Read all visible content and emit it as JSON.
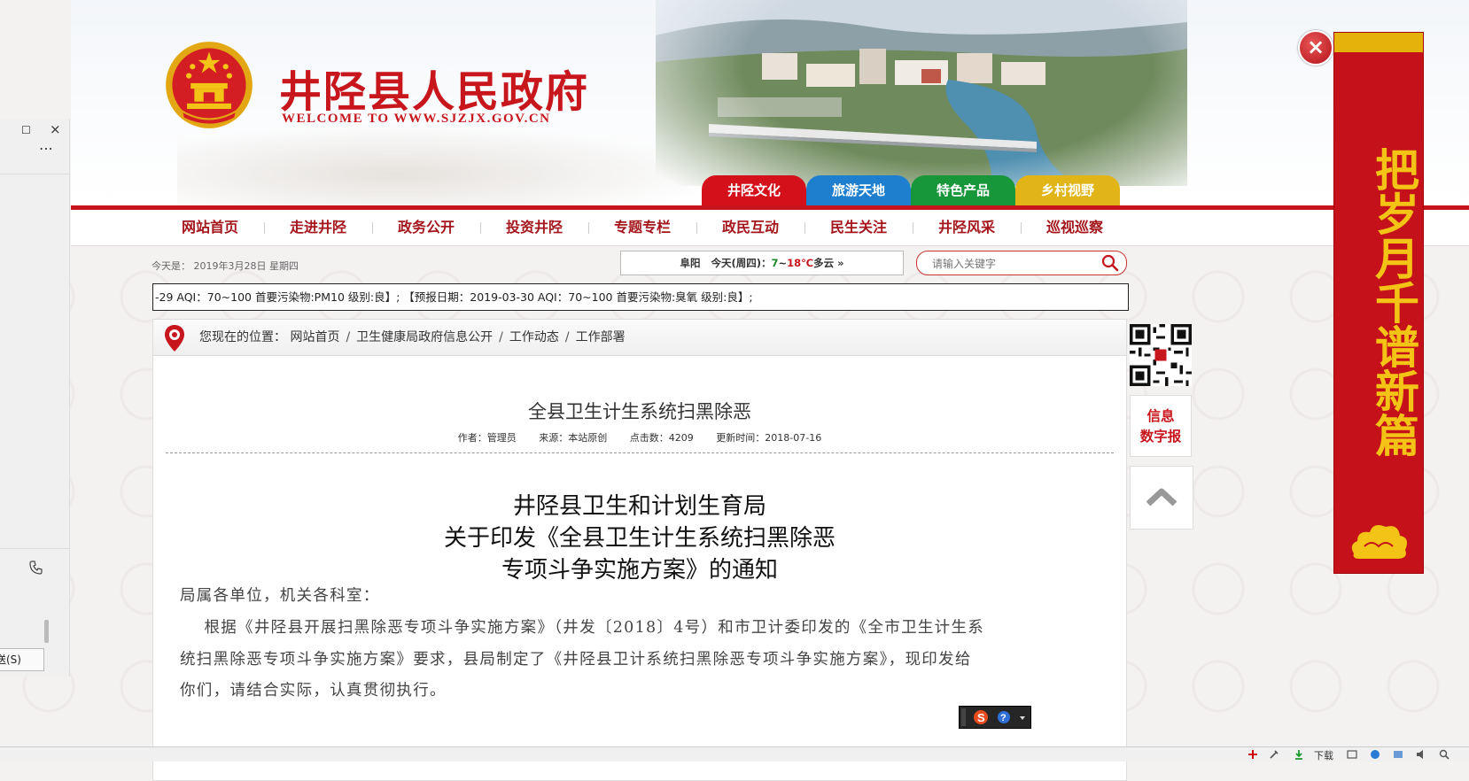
{
  "header": {
    "site_title": "井陉县人民政府",
    "site_subtitle": "WELCOME TO WWW.SJZJX.GOV.CN",
    "category_tabs": [
      {
        "label": "井陉文化",
        "color": "#d4101b"
      },
      {
        "label": "旅游天地",
        "color": "#1e7fcf"
      },
      {
        "label": "特色产品",
        "color": "#18963a"
      },
      {
        "label": "乡村视野",
        "color": "#e1b417"
      }
    ]
  },
  "nav": {
    "items": [
      "网站首页",
      "走进井陉",
      "政务公开",
      "投资井陉",
      "专题专栏",
      "政民互动",
      "民生关注",
      "井陉风采",
      "巡视巡察"
    ]
  },
  "info": {
    "date_label": "今天是：",
    "date_value": "2019年3月28日  星期四",
    "weather_city": "阜阳",
    "weather_day": "今天(周四)：",
    "weather_low": "7",
    "weather_sep": "~",
    "weather_high": "18℃",
    "weather_cond": "多云",
    "weather_more": "»",
    "search_placeholder": "请输入关键字",
    "ticker": "-29 AQI：70~100 首要污染物:PM10 级别:良】; 【预报日期：2019-03-30 AQI：70~100 首要污染物:臭氧 级别:良】;"
  },
  "breadcrumb": {
    "prefix": "您现在的位置：",
    "items": [
      "网站首页",
      "卫生健康局政府信息公开",
      "工作动态",
      "工作部署"
    ],
    "separator": "/"
  },
  "article": {
    "title": "全县卫生计生系统扫黑除恶",
    "author": "作者：管理员",
    "source": "来源：本站原创",
    "hits": "点击数：4209",
    "updated": "更新时间：2018-07-16",
    "doc_heading": [
      "井陉县卫生和计划生育局",
      "关于印发《全县卫生计生系统扫黑除恶",
      "专项斗争实施方案》的通知"
    ],
    "body_lines": [
      "局属各单位，机关各科室：",
      "    根据《井陉县开展扫黑除恶专项斗争实施方案》（井发〔2018〕4号）和市卫计委印发的《全市卫生计生系",
      "统扫黑除恶专项斗争实施方案》要求，县局制定了《井陉县卫计系统扫黑除恶专项斗争实施方案》，现印发给",
      "你们，请结合实际，认真贯彻执行。"
    ]
  },
  "sidebar": {
    "info_label": [
      "信息",
      "数字报"
    ]
  },
  "couplet": {
    "text": "把岁月千谱新篇",
    "close_label": "×"
  },
  "left_panel": {
    "max_glyph": "☐",
    "close_glyph": "×",
    "more_glyph": "⋯",
    "send_label": "发送(S)"
  },
  "statusbar": {
    "download_label": "下载"
  },
  "colors": {
    "brand_red": "#c8161d",
    "nav_text": "#a4161c",
    "couplet_gold": "#f3c315"
  },
  "icons": [
    "national-emblem-icon",
    "search-icon",
    "location-pin-icon",
    "qr-code",
    "arrow-up-icon",
    "close-icon",
    "phone-icon",
    "cloud-ornament-icon"
  ]
}
